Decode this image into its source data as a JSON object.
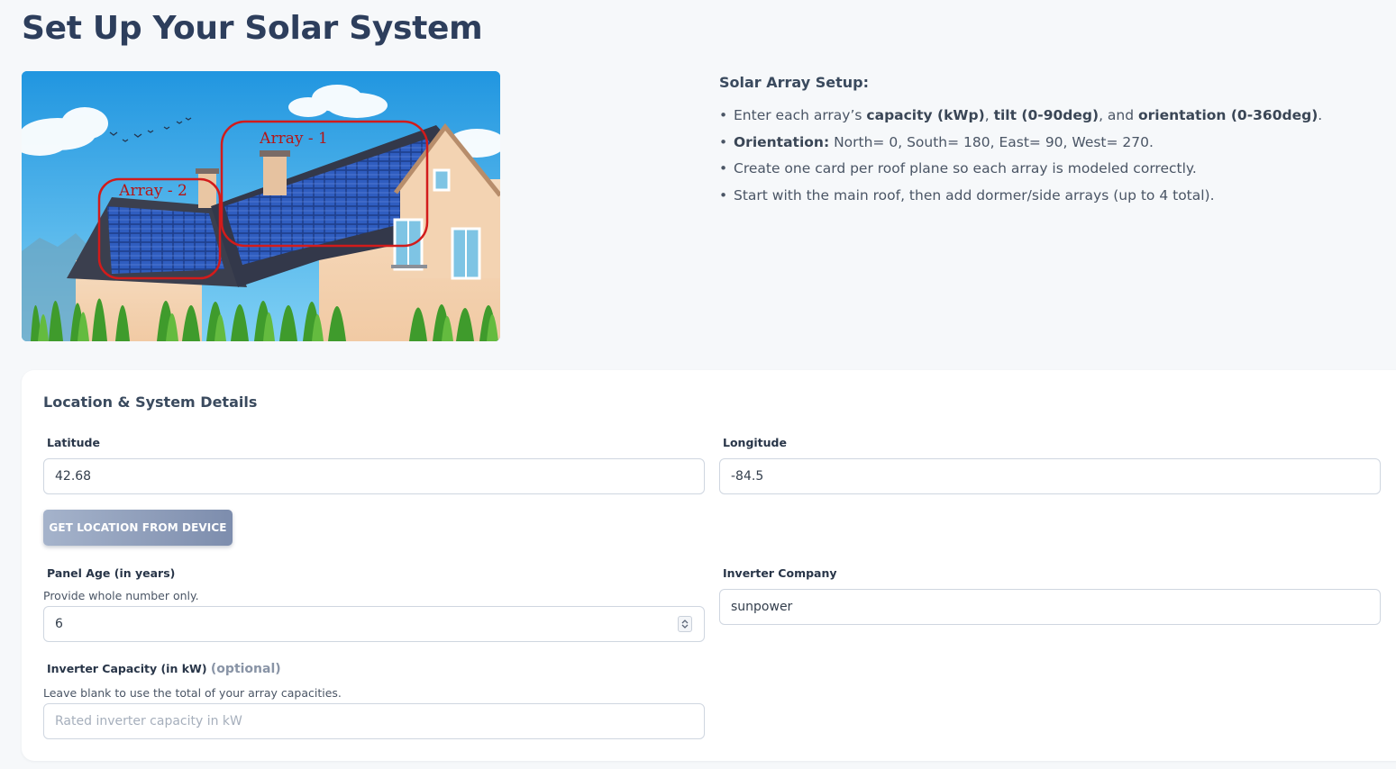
{
  "page": {
    "title": "Set Up Your Solar System"
  },
  "hero_image": {
    "array_1_label": "Array - 1",
    "array_2_label": "Array - 2"
  },
  "instructions": {
    "title": "Solar Array Setup:",
    "bullets": {
      "b1": {
        "pre": "Enter each array’s ",
        "k1": "capacity (kWp)",
        "s1": ", ",
        "k2": "tilt (0-90deg)",
        "s2": ", and ",
        "k3": "orientation (0-360deg)",
        "end": "."
      },
      "b2": {
        "key": "Orientation:",
        "text": " North= 0, South= 180, East= 90, West= 270."
      },
      "b3": {
        "text": "Create one card per roof plane so each array is modeled correctly."
      },
      "b4": {
        "text": "Start with the main roof, then add dormer/side arrays (up to 4 total)."
      }
    },
    "bullet_glyph": "•"
  },
  "form": {
    "title": "Location & System Details",
    "latitude": {
      "label": "Latitude",
      "value": "42.68"
    },
    "longitude": {
      "label": "Longitude",
      "value": "-84.5"
    },
    "location_button": "GET LOCATION FROM DEVICE",
    "panel_age": {
      "label": "Panel Age (in years)",
      "help": "Provide whole number only.",
      "value": "6"
    },
    "inverter_company": {
      "label": "Inverter Company",
      "value": "sunpower"
    },
    "inverter_capacity": {
      "label": "Inverter Capacity (in kW)",
      "optional": "(optional)",
      "help": "Leave blank to use the total of your array capacities.",
      "placeholder": "Rated inverter capacity in kW"
    }
  },
  "colors": {
    "title": "#2d3e5c",
    "array_outline": "#d21b1b",
    "button_gradient_start": "#a5b3cb",
    "button_gradient_end": "#7d8dad"
  }
}
